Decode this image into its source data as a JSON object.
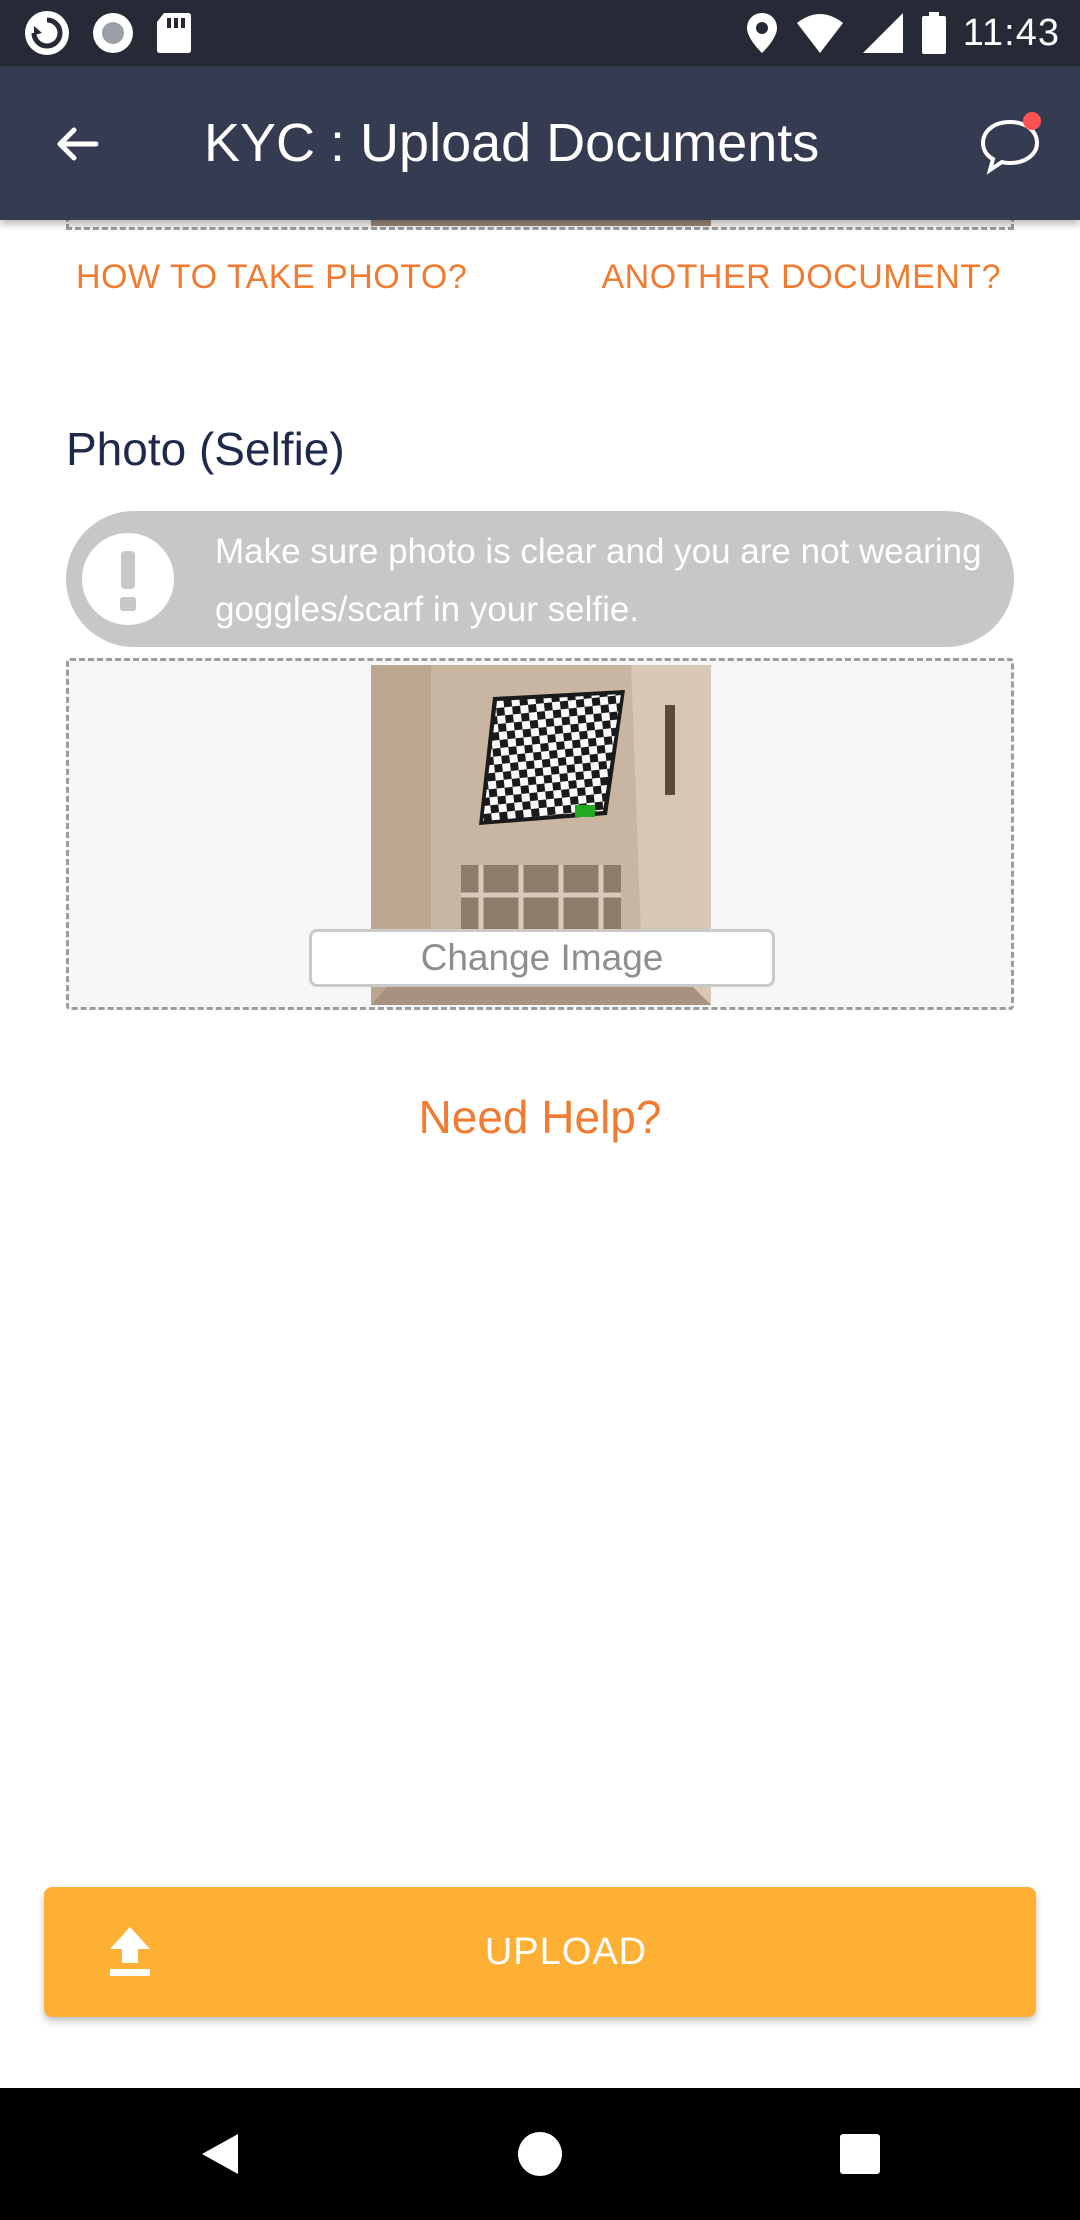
{
  "status_bar": {
    "time": "11:43",
    "left_icons": [
      "sync-icon",
      "record-icon",
      "sd-card-icon"
    ],
    "right_icons": [
      "location-icon",
      "wifi-icon",
      "signal-icon",
      "battery-icon"
    ]
  },
  "app_bar": {
    "title": "KYC : Upload Documents",
    "back_icon": "arrow-back-icon",
    "chat_icon": "chat-bubble-icon",
    "chat_has_notification": true
  },
  "document_section": {
    "how_to_link": "HOW TO TAKE PHOTO?",
    "another_doc_link": "ANOTHER DOCUMENT?"
  },
  "selfie_section": {
    "title": "Photo (Selfie)",
    "warning_text": "Make sure photo is clear and you are not wearing goggles/scarf in your selfie.",
    "change_image_label": "Change Image"
  },
  "need_help": "Need Help?",
  "upload_button": {
    "label": "UPLOAD",
    "icon": "upload-icon"
  },
  "colors": {
    "app_bar": "#353c51",
    "status_bar": "#262a36",
    "accent_orange": "#f07b31",
    "upload_button": "#fdb034",
    "warning_bg": "#c7c6c8",
    "notification_dot": "#ff5252"
  }
}
